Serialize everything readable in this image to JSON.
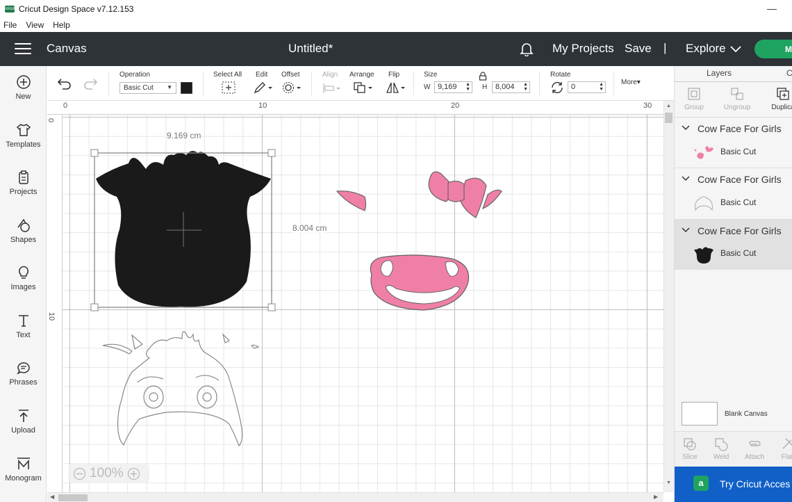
{
  "window": {
    "title": "Cricut Design Space  v7.12.153",
    "logo_text": "cricut",
    "minimize_glyph": "—"
  },
  "menu": [
    "File",
    "View",
    "Help"
  ],
  "header": {
    "section": "Canvas",
    "document": "Untitled*",
    "my_projects": "My Projects",
    "save": "Save",
    "separator": "|",
    "explore": "Explore",
    "make_label": "M"
  },
  "sidebar": [
    {
      "label": "New",
      "icon": "plus-circle-icon"
    },
    {
      "label": "Templates",
      "icon": "shirt-icon"
    },
    {
      "label": "Projects",
      "icon": "clipboard-icon"
    },
    {
      "label": "Shapes",
      "icon": "shapes-icon"
    },
    {
      "label": "Images",
      "icon": "bulb-icon"
    },
    {
      "label": "Text",
      "icon": "text-icon"
    },
    {
      "label": "Phrases",
      "icon": "speech-bubble-icon"
    },
    {
      "label": "Upload",
      "icon": "upload-icon"
    },
    {
      "label": "Monogram",
      "icon": "monogram-icon"
    }
  ],
  "toolbar": {
    "operation_label": "Operation",
    "operation_value": "Basic Cut",
    "operation_color": "#1a1a1a",
    "select_all": "Select All",
    "edit": "Edit",
    "offset": "Offset",
    "align": "Align",
    "arrange": "Arrange",
    "flip": "Flip",
    "size": "Size",
    "w_label": "W",
    "w_value": "9,169",
    "h_label": "H",
    "h_value": "8,004",
    "rotate": "Rotate",
    "rotate_value": "0",
    "more": "More▾"
  },
  "canvas": {
    "ruler_x": [
      "0",
      "10",
      "20",
      "30"
    ],
    "ruler_y": [
      "0",
      "10"
    ],
    "width_label": "9.169 cm",
    "height_label": "8.004 cm",
    "zoom": "100%",
    "pink": "#f07fa7",
    "black": "#1a1a1a"
  },
  "layers_panel": {
    "tab_layers": "Layers",
    "tab_color": "C",
    "tools": [
      "Group",
      "Ungroup",
      "Duplica"
    ],
    "groups": [
      {
        "title": "Cow Face For Girls",
        "item": "Basic Cut"
      },
      {
        "title": "Cow Face For Girls",
        "item": "Basic Cut"
      },
      {
        "title": "Cow Face For Girls",
        "item": "Basic Cut"
      }
    ],
    "blank_canvas": "Blank Canvas",
    "bottom_tools": [
      "Slice",
      "Weld",
      "Attach",
      "Flat"
    ],
    "access_text": "Try Cricut Acces",
    "access_logo": "a"
  }
}
